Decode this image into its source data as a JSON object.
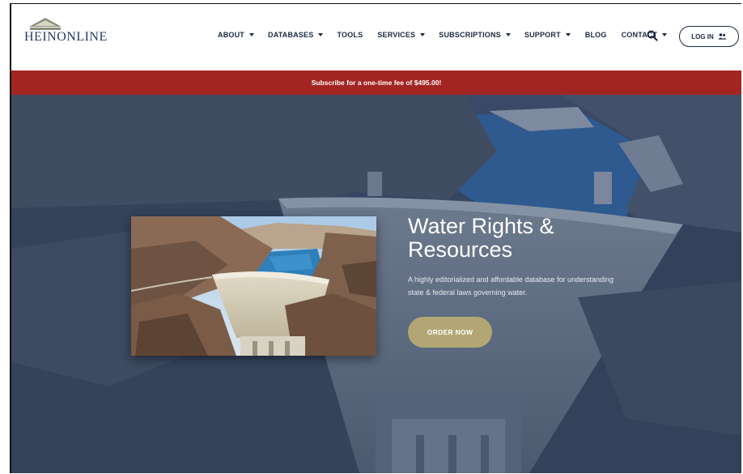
{
  "logo": {
    "text": "HEINONLINE"
  },
  "nav": {
    "items": [
      {
        "label": "ABOUT",
        "dropdown": true
      },
      {
        "label": "DATABASES",
        "dropdown": true
      },
      {
        "label": "TOOLS",
        "dropdown": false
      },
      {
        "label": "SERVICES",
        "dropdown": true
      },
      {
        "label": "SUBSCRIPTIONS",
        "dropdown": true
      },
      {
        "label": "SUPPORT",
        "dropdown": true
      },
      {
        "label": "BLOG",
        "dropdown": false
      },
      {
        "label": "CONTACT",
        "dropdown": true
      }
    ],
    "search_icon": "search-icon",
    "login_label": "LOG IN",
    "login_icon": "users-icon"
  },
  "banner": {
    "text": "Subscribe for a one-time fee of $495.00!"
  },
  "hero": {
    "title_line1": "Water Rights &",
    "title_line2": "Resources",
    "description_line1": "A highly editorialized and affordable database for understanding",
    "description_line2": "state & federal laws governing water.",
    "button_label": "ORDER NOW"
  },
  "colors": {
    "navy": "#1d2a44",
    "banner_red": "#a32523",
    "button_gold": "#b2a774",
    "hero_overlay": "#2f3f5c"
  }
}
